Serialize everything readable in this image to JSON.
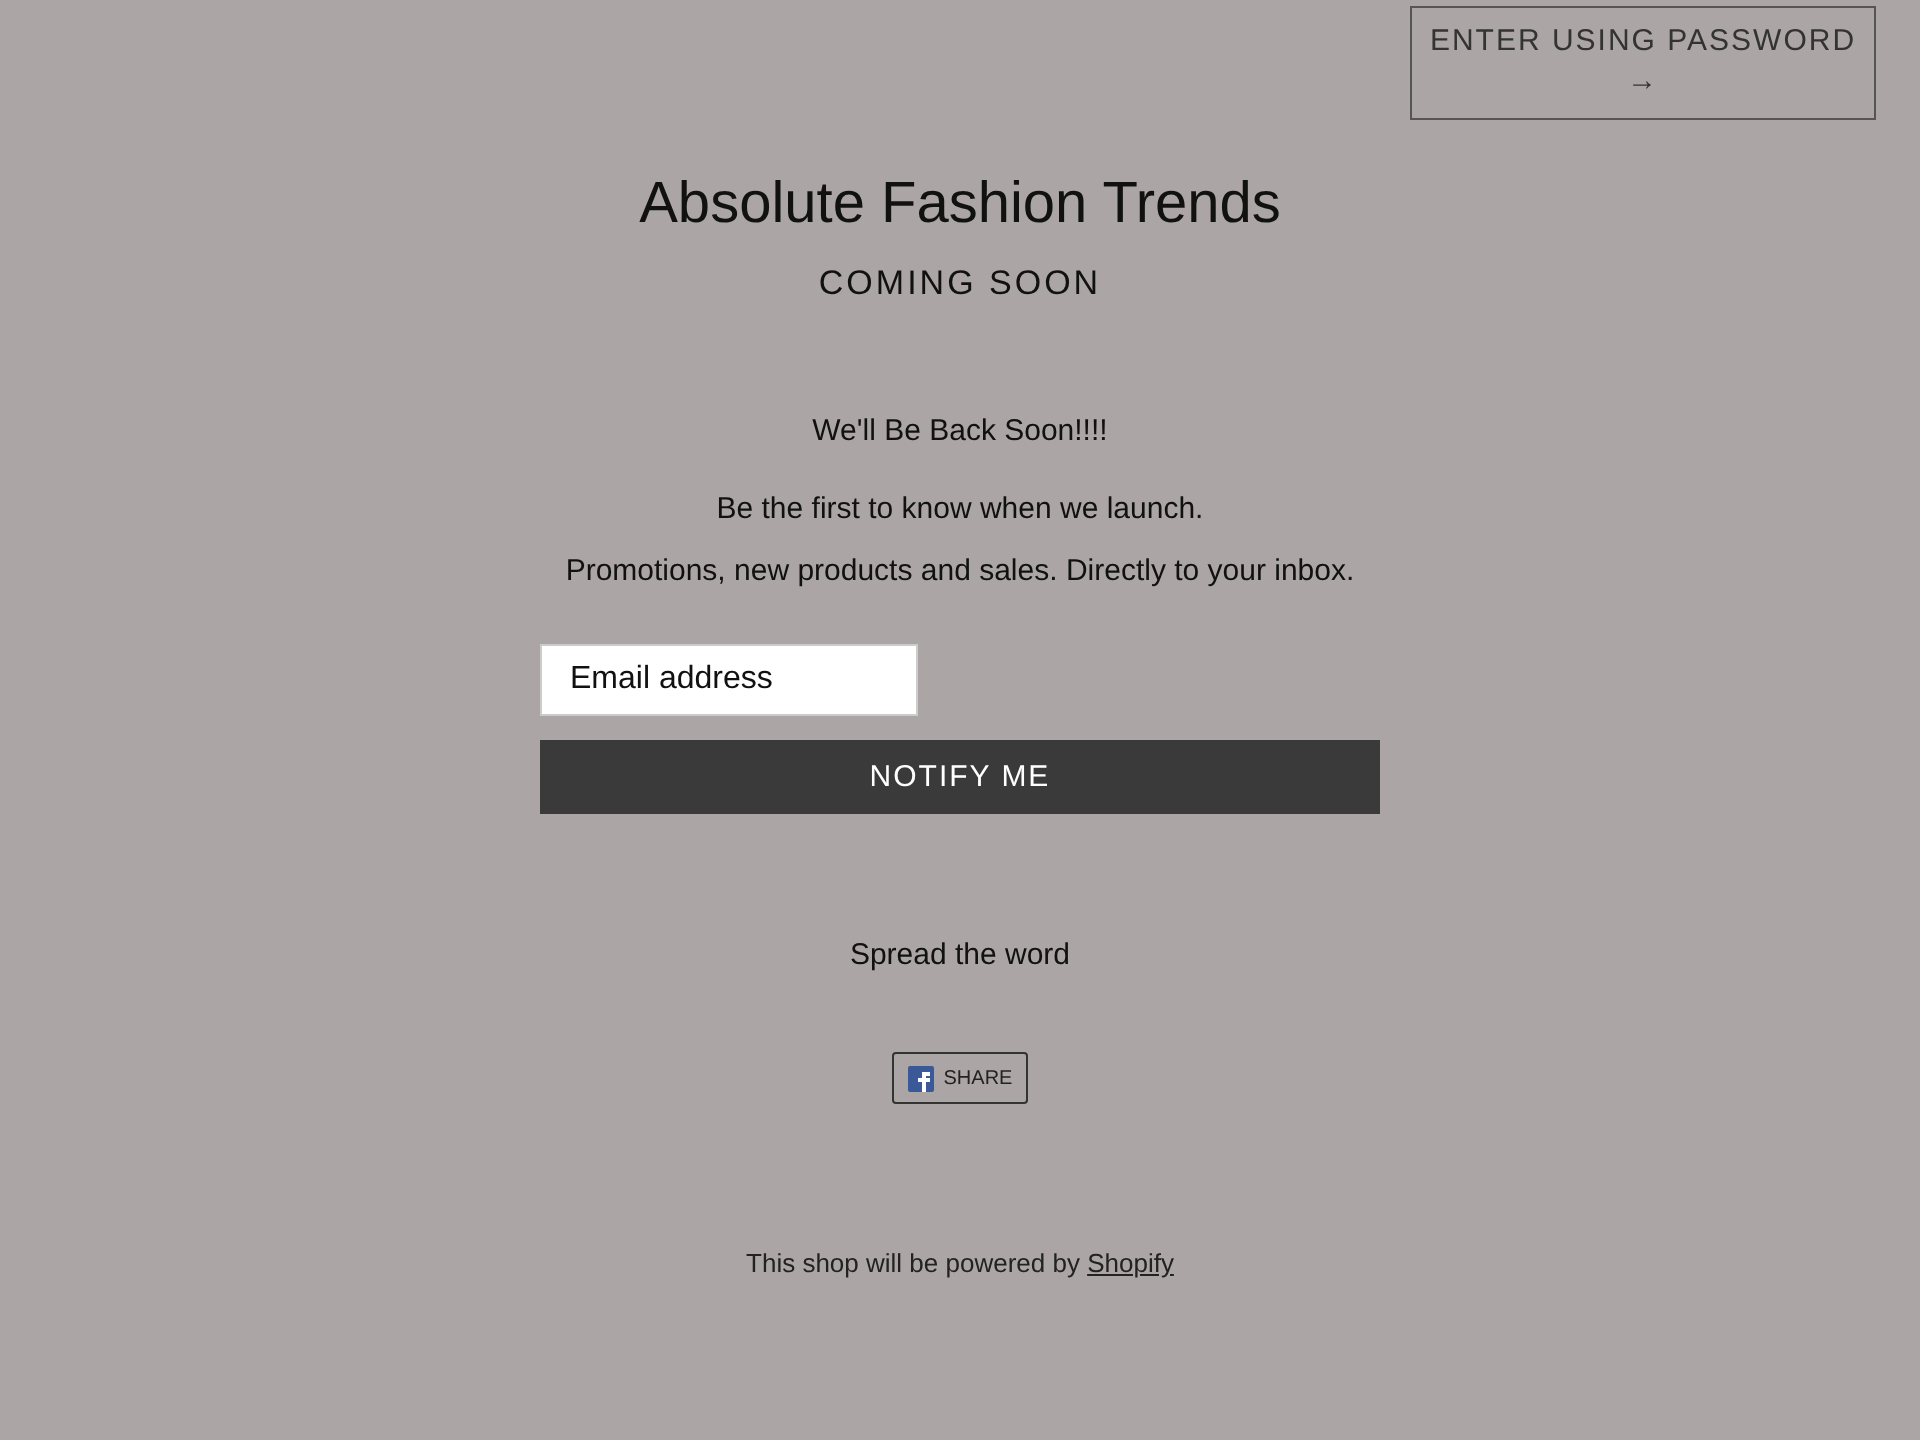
{
  "header": {
    "password_button": "ENTER USING PASSWORD",
    "password_arrow": "→"
  },
  "title": "Absolute Fashion Trends",
  "subtitle": "COMING SOON",
  "message": [
    "We'll Be Back Soon!!!!",
    "Be the first to know when we launch.",
    "Promotions, new products and sales. Directly to your inbox."
  ],
  "signup": {
    "placeholder": "Email address",
    "button": "NOTIFY ME"
  },
  "share": {
    "heading": "Spread the word",
    "button": "SHARE"
  },
  "footer": {
    "text": "This shop will be powered by",
    "link": "Shopify"
  }
}
